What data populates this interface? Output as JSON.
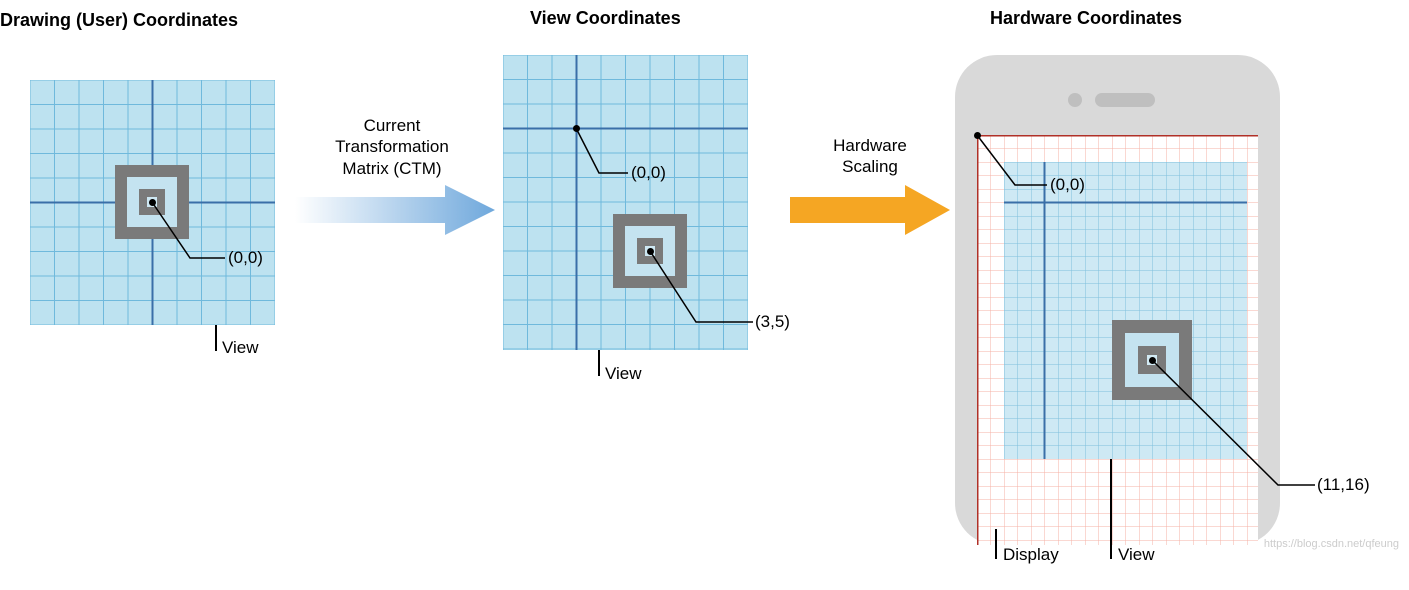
{
  "headings": {
    "user": "Drawing (User) Coordinates",
    "view": "View Coordinates",
    "hardware": "Hardware Coordinates"
  },
  "arrows": {
    "ctm": "Current\nTransformation\nMatrix (CTM)",
    "hw": "Hardware\nScaling"
  },
  "panel_user": {
    "origin_label": "(0,0)",
    "view_label": "View"
  },
  "panel_view": {
    "origin_label": "(0,0)",
    "point_label": "(3,5)",
    "view_label": "View"
  },
  "panel_hw": {
    "origin_label": "(0,0)",
    "point_label": "(11,16)",
    "display_label": "Display",
    "view_label": "View"
  },
  "watermark": "https://blog.csdn.net/qfeung"
}
